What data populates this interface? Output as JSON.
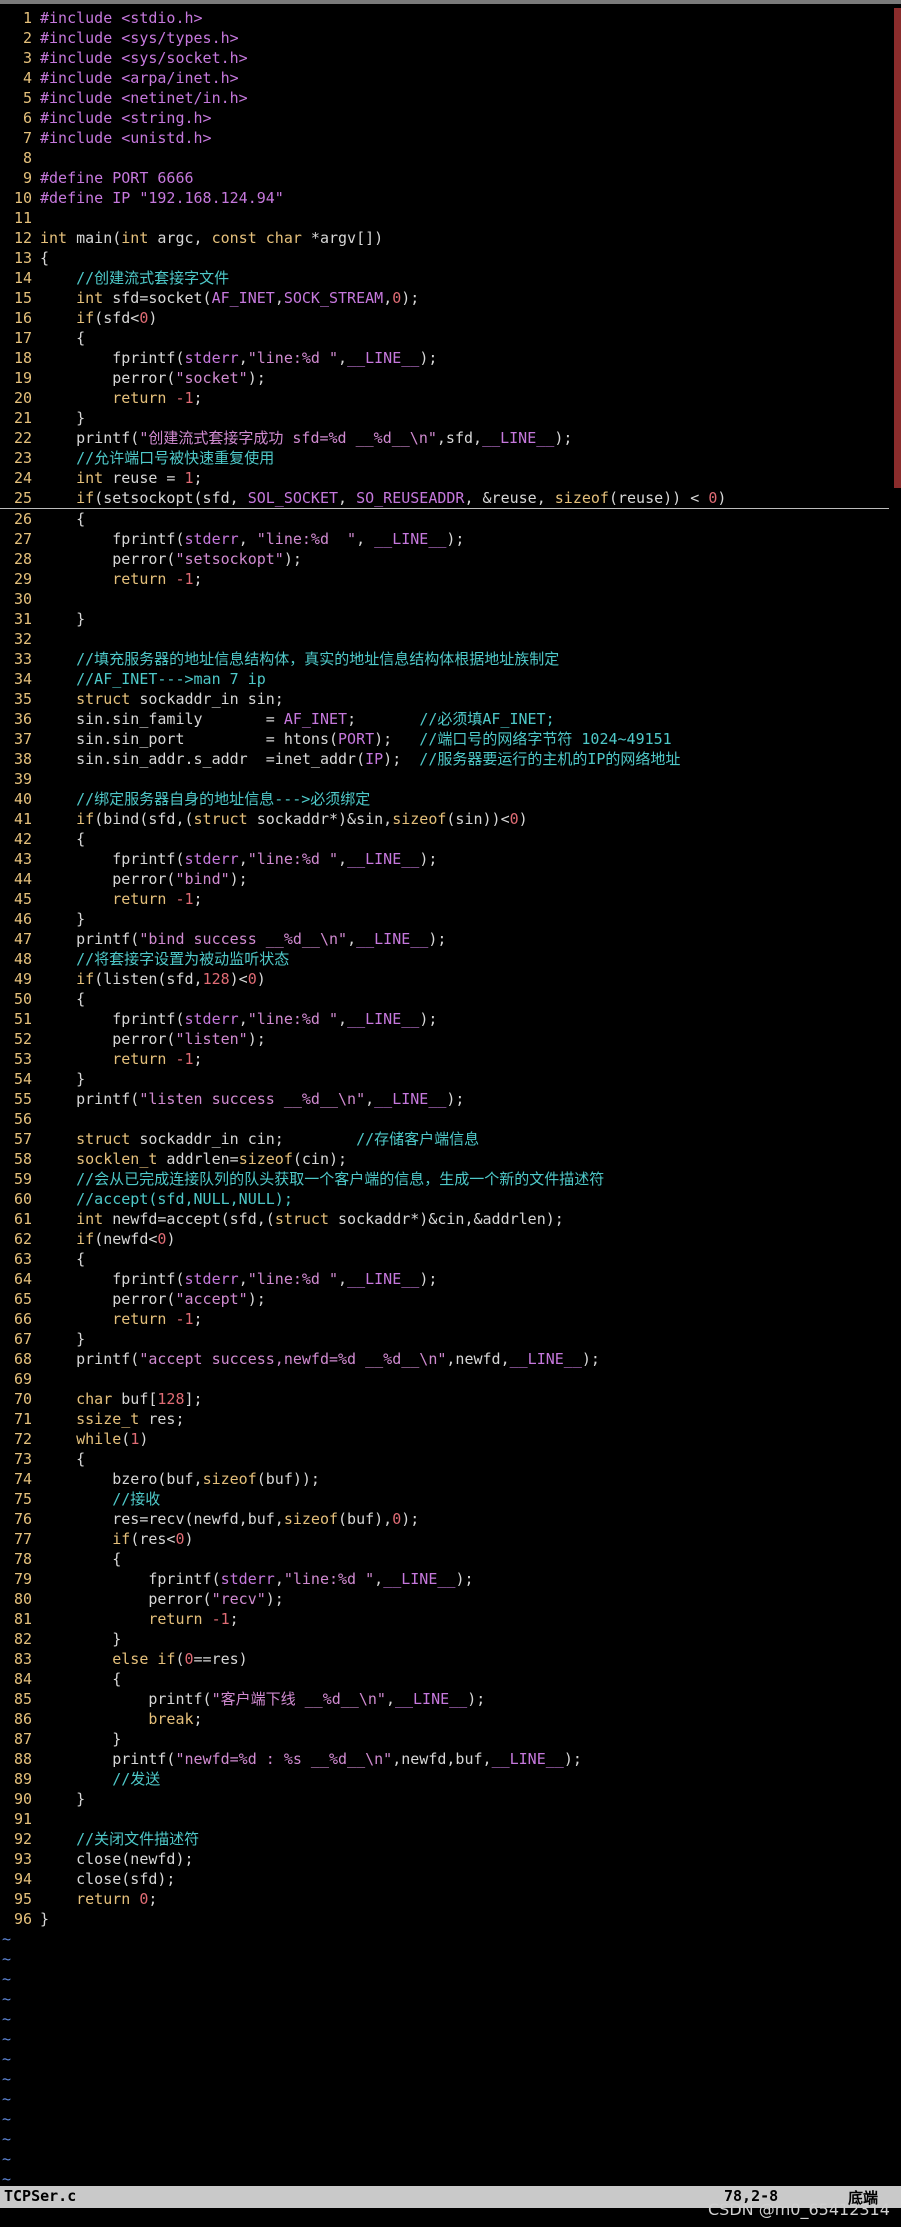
{
  "editor": {
    "lines": [
      {
        "n": "1",
        "code": "#include <stdio.h>"
      },
      {
        "n": "2",
        "code": "#include <sys/types.h>"
      },
      {
        "n": "3",
        "code": "#include <sys/socket.h>"
      },
      {
        "n": "4",
        "code": "#include <arpa/inet.h>"
      },
      {
        "n": "5",
        "code": "#include <netinet/in.h>"
      },
      {
        "n": "6",
        "code": "#include <string.h>"
      },
      {
        "n": "7",
        "code": "#include <unistd.h>"
      },
      {
        "n": "8",
        "code": ""
      },
      {
        "n": "9",
        "code": "#define PORT 6666"
      },
      {
        "n": "10",
        "code": "#define IP \"192.168.124.94\""
      },
      {
        "n": "11",
        "code": ""
      },
      {
        "n": "12",
        "code": "int main(int argc, const char *argv[])"
      },
      {
        "n": "13",
        "code": "{"
      },
      {
        "n": "14",
        "code": "    //创建流式套接字文件"
      },
      {
        "n": "15",
        "code": "    int sfd=socket(AF_INET,SOCK_STREAM,0);"
      },
      {
        "n": "16",
        "code": "    if(sfd<0)"
      },
      {
        "n": "17",
        "code": "    {"
      },
      {
        "n": "18",
        "code": "        fprintf(stderr,\"line:%d \",__LINE__);"
      },
      {
        "n": "19",
        "code": "        perror(\"socket\");"
      },
      {
        "n": "20",
        "code": "        return -1;"
      },
      {
        "n": "21",
        "code": "    }"
      },
      {
        "n": "22",
        "code": "    printf(\"创建流式套接字成功 sfd=%d __%d__\\n\",sfd,__LINE__);"
      },
      {
        "n": "23",
        "code": "    //允许端口号被快速重复使用"
      },
      {
        "n": "24",
        "code": "    int reuse = 1;"
      },
      {
        "n": "25",
        "code": "    if(setsockopt(sfd, SOL_SOCKET, SO_REUSEADDR, &reuse, sizeof(reuse)) < 0)"
      },
      {
        "n": "26",
        "code": "    {"
      },
      {
        "n": "27",
        "code": "        fprintf(stderr, \"line:%d  \", __LINE__);"
      },
      {
        "n": "28",
        "code": "        perror(\"setsockopt\");"
      },
      {
        "n": "29",
        "code": "        return -1;"
      },
      {
        "n": "30",
        "code": ""
      },
      {
        "n": "31",
        "code": "    }"
      },
      {
        "n": "32",
        "code": ""
      },
      {
        "n": "33",
        "code": "    //填充服务器的地址信息结构体，真实的地址信息结构体根据地址族制定"
      },
      {
        "n": "34",
        "code": "    //AF_INET--->man 7 ip"
      },
      {
        "n": "35",
        "code": "    struct sockaddr_in sin;"
      },
      {
        "n": "36",
        "code": "    sin.sin_family       = AF_INET;       //必须填AF_INET;"
      },
      {
        "n": "37",
        "code": "    sin.sin_port         = htons(PORT);   //端口号的网络字节符 1024~49151"
      },
      {
        "n": "38",
        "code": "    sin.sin_addr.s_addr  =inet_addr(IP);  //服务器要运行的主机的IP的网络地址"
      },
      {
        "n": "39",
        "code": ""
      },
      {
        "n": "40",
        "code": "    //绑定服务器自身的地址信息--->必须绑定"
      },
      {
        "n": "41",
        "code": "    if(bind(sfd,(struct sockaddr*)&sin,sizeof(sin))<0)"
      },
      {
        "n": "42",
        "code": "    {"
      },
      {
        "n": "43",
        "code": "        fprintf(stderr,\"line:%d \",__LINE__);"
      },
      {
        "n": "44",
        "code": "        perror(\"bind\");"
      },
      {
        "n": "45",
        "code": "        return -1;"
      },
      {
        "n": "46",
        "code": "    }"
      },
      {
        "n": "47",
        "code": "    printf(\"bind success __%d__\\n\",__LINE__);"
      },
      {
        "n": "48",
        "code": "    //将套接字设置为被动监听状态"
      },
      {
        "n": "49",
        "code": "    if(listen(sfd,128)<0)"
      },
      {
        "n": "50",
        "code": "    {"
      },
      {
        "n": "51",
        "code": "        fprintf(stderr,\"line:%d \",__LINE__);"
      },
      {
        "n": "52",
        "code": "        perror(\"listen\");"
      },
      {
        "n": "53",
        "code": "        return -1;"
      },
      {
        "n": "54",
        "code": "    }"
      },
      {
        "n": "55",
        "code": "    printf(\"listen success __%d__\\n\",__LINE__);"
      },
      {
        "n": "56",
        "code": ""
      },
      {
        "n": "57",
        "code": "    struct sockaddr_in cin;        //存储客户端信息"
      },
      {
        "n": "58",
        "code": "    socklen_t addrlen=sizeof(cin);"
      },
      {
        "n": "59",
        "code": "    //会从已完成连接队列的队头获取一个客户端的信息，生成一个新的文件描述符"
      },
      {
        "n": "60",
        "code": "    //accept(sfd,NULL,NULL);"
      },
      {
        "n": "61",
        "code": "    int newfd=accept(sfd,(struct sockaddr*)&cin,&addrlen);"
      },
      {
        "n": "62",
        "code": "    if(newfd<0)"
      },
      {
        "n": "63",
        "code": "    {"
      },
      {
        "n": "64",
        "code": "        fprintf(stderr,\"line:%d \",__LINE__);"
      },
      {
        "n": "65",
        "code": "        perror(\"accept\");"
      },
      {
        "n": "66",
        "code": "        return -1;"
      },
      {
        "n": "67",
        "code": "    }"
      },
      {
        "n": "68",
        "code": "    printf(\"accept success,newfd=%d __%d__\\n\",newfd,__LINE__);"
      },
      {
        "n": "69",
        "code": ""
      },
      {
        "n": "70",
        "code": "    char buf[128];"
      },
      {
        "n": "71",
        "code": "    ssize_t res;"
      },
      {
        "n": "72",
        "code": "    while(1)"
      },
      {
        "n": "73",
        "code": "    {"
      },
      {
        "n": "74",
        "code": "        bzero(buf,sizeof(buf));"
      },
      {
        "n": "75",
        "code": "        //接收"
      },
      {
        "n": "76",
        "code": "        res=recv(newfd,buf,sizeof(buf),0);"
      },
      {
        "n": "77",
        "code": "        if(res<0)"
      },
      {
        "n": "78",
        "code": "        {"
      },
      {
        "n": "79",
        "code": "            fprintf(stderr,\"line:%d \",__LINE__);"
      },
      {
        "n": "80",
        "code": "            perror(\"recv\");"
      },
      {
        "n": "81",
        "code": "            return -1;"
      },
      {
        "n": "82",
        "code": "        }"
      },
      {
        "n": "83",
        "code": "        else if(0==res)"
      },
      {
        "n": "84",
        "code": "        {"
      },
      {
        "n": "85",
        "code": "            printf(\"客户端下线 __%d__\\n\",__LINE__);"
      },
      {
        "n": "86",
        "code": "            break;"
      },
      {
        "n": "87",
        "code": "        }"
      },
      {
        "n": "88",
        "code": "        printf(\"newfd=%d : %s __%d__\\n\",newfd,buf,__LINE__);"
      },
      {
        "n": "89",
        "code": "        //发送"
      },
      {
        "n": "90",
        "code": "    }"
      },
      {
        "n": "91",
        "code": ""
      },
      {
        "n": "92",
        "code": "    //关闭文件描述符"
      },
      {
        "n": "93",
        "code": "    close(newfd);"
      },
      {
        "n": "94",
        "code": "    close(sfd);"
      },
      {
        "n": "95",
        "code": "    return 0;"
      },
      {
        "n": "96",
        "code": "}"
      }
    ],
    "tilde": "~",
    "tilde_count": 13
  },
  "status": {
    "filename": "TCPSer.c",
    "position": "78,2-8",
    "scroll": "底端"
  },
  "watermark": "CSDN @m0_65412314",
  "colors": {
    "background": "#000000",
    "line_number": "#e5c07b",
    "preproc": "#c678dd",
    "keyword": "#e5c07b",
    "string": "#d08ad0",
    "comment": "#4ec9c9",
    "number": "#e06c75",
    "macro": "#c678dd",
    "tilde": "#5f87d7",
    "status_bg": "#c9c9c9"
  }
}
